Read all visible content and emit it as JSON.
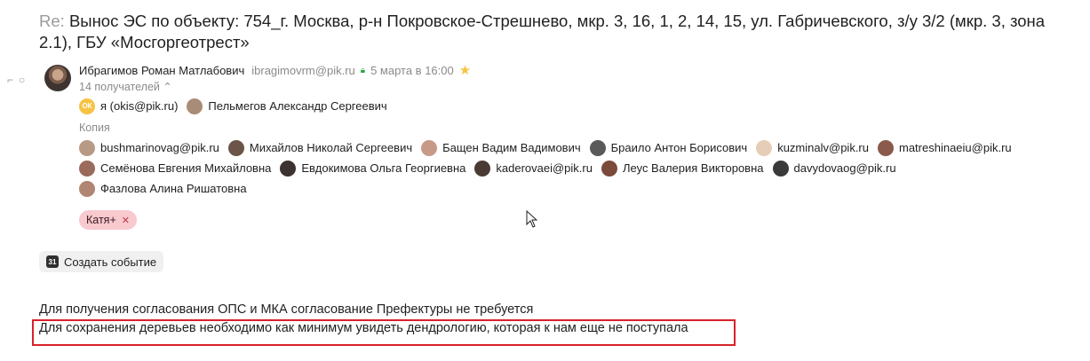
{
  "email": {
    "subject_prefix": "Re:",
    "subject": "Вынос ЭС по объекту: 754_г. Москва, р-н Покровское-Стрешнево, мкр. 3, 16, 1, 2, 14, 15, ул. Габричевского, з/у 3/2 (мкр. 3, зона 2.1), ГБУ «Мосгоргеотрест»",
    "sender_name": "Ибрагимов Роман Матлабович",
    "sender_email": "ibragimovrm@pik.ru",
    "date": "5 марта в 16:00",
    "recipients_count": "14 получателей"
  },
  "to": [
    {
      "avatar": "ОК",
      "name": "я (okis@pik.ru)"
    },
    {
      "name": "Пельмегов Александр Сергеевич"
    }
  ],
  "copy_label": "Копия",
  "cc_row1": [
    {
      "name": "bushmarinovag@pik.ru"
    },
    {
      "name": "Михайлов Николай Сергеевич"
    },
    {
      "name": "Бащен Вадим Вадимович"
    },
    {
      "name": "Браило Антон Борисович"
    },
    {
      "name": "kuzminalv@pik.ru"
    },
    {
      "name": "matreshinaeiu@pik.ru"
    }
  ],
  "cc_row2": [
    {
      "name": "Семёнова Евгения Михайловна"
    },
    {
      "name": "Евдокимова Ольга Георгиевна"
    },
    {
      "name": "kaderovaei@pik.ru"
    },
    {
      "name": "Леус Валерия Викторовна"
    },
    {
      "name": "davydovaog@pik.ru"
    }
  ],
  "cc_row3": [
    {
      "name": "Фазлова Алина Ришатовна"
    }
  ],
  "tag": {
    "label": "Катя+"
  },
  "create_event": {
    "icon_text": "31",
    "label": "Создать событие"
  },
  "body": [
    "Для получения согласования ОПС и МКА согласование Префектуры не требуется",
    "Для сохранения деревьев необходимо как минимум увидеть дендрологию, которая к нам еще не поступала"
  ],
  "colors": {
    "accent_tag": "#f8c9cf",
    "highlight_box": "#d9212c",
    "star": "#f6c343",
    "lock": "#2ba24c"
  }
}
